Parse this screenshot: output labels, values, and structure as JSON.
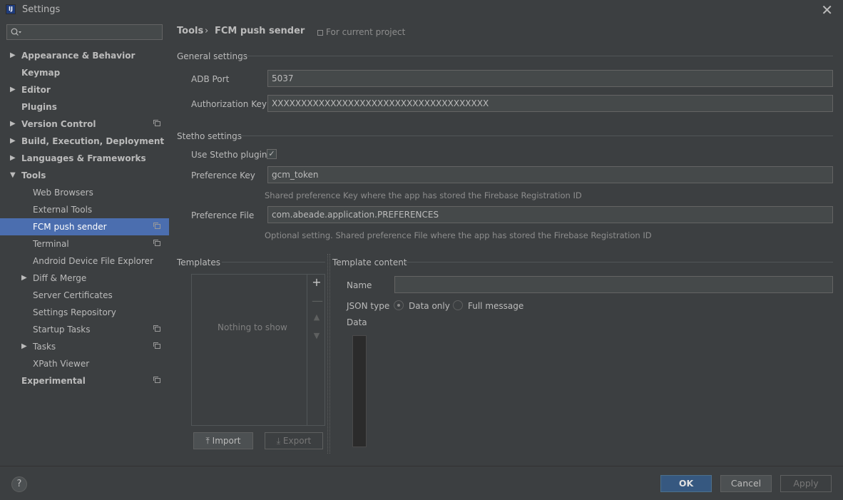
{
  "window": {
    "title": "Settings"
  },
  "sidebar": {
    "search_placeholder": "",
    "items": [
      {
        "label": "Appearance & Behavior"
      },
      {
        "label": "Keymap"
      },
      {
        "label": "Editor"
      },
      {
        "label": "Plugins"
      },
      {
        "label": "Version Control"
      },
      {
        "label": "Build, Execution, Deployment"
      },
      {
        "label": "Languages & Frameworks"
      },
      {
        "label": "Tools"
      },
      {
        "label": "Web Browsers"
      },
      {
        "label": "External Tools"
      },
      {
        "label": "FCM push sender"
      },
      {
        "label": "Terminal"
      },
      {
        "label": "Android Device File Explorer"
      },
      {
        "label": "Diff & Merge"
      },
      {
        "label": "Server Certificates"
      },
      {
        "label": "Settings Repository"
      },
      {
        "label": "Startup Tasks"
      },
      {
        "label": "Tasks"
      },
      {
        "label": "XPath Viewer"
      },
      {
        "label": "Experimental"
      }
    ]
  },
  "breadcrumb": {
    "parent": "Tools",
    "separator": "›",
    "current": "FCM push sender",
    "scope": "For current project"
  },
  "general": {
    "title": "General settings",
    "adb_port_label": "ADB Port",
    "adb_port_value": "5037",
    "auth_key_label": "Authorization Key",
    "auth_key_value": "XXXXXXXXXXXXXXXXXXXXXXXXXXXXXXXXXXXXX"
  },
  "stetho": {
    "title": "Stetho settings",
    "use_plugin_label": "Use Stetho plugin",
    "use_plugin_checked": true,
    "pref_key_label": "Preference Key",
    "pref_key_value": "gcm_token",
    "pref_key_hint": "Shared preference Key where the app has stored the Firebase Registration ID",
    "pref_file_label": "Preference File",
    "pref_file_value": "com.abeade.application.PREFERENCES",
    "pref_file_hint": "Optional setting. Shared preference File where the app has stored the Firebase Registration ID"
  },
  "templates": {
    "title": "Templates",
    "empty_text": "Nothing to show",
    "import_label": "Import",
    "export_label": "Export"
  },
  "template_content": {
    "title": "Template content",
    "name_label": "Name",
    "name_value": "",
    "json_type_label": "JSON type",
    "option_data_only": "Data only",
    "option_full_message": "Full message",
    "selected_option": "Data only",
    "data_label": "Data"
  },
  "footer": {
    "help": "?",
    "ok": "OK",
    "cancel": "Cancel",
    "apply": "Apply"
  }
}
